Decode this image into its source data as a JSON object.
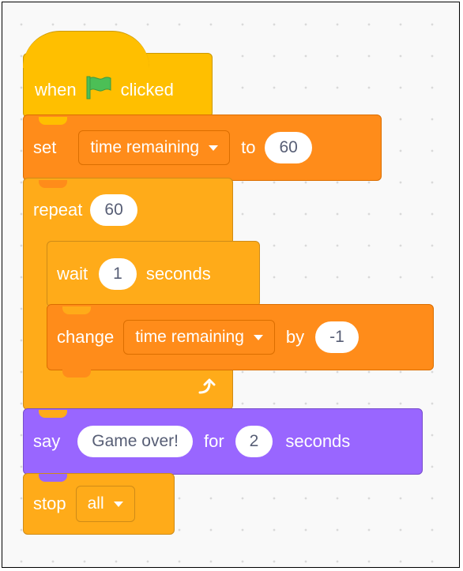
{
  "script": {
    "hat": {
      "when_label": "when",
      "clicked_label": "clicked"
    },
    "set_block": {
      "label": "set",
      "variable": "time remaining",
      "to_label": "to",
      "value": "60"
    },
    "repeat_block": {
      "label": "repeat",
      "count": "60"
    },
    "wait_block": {
      "label": "wait",
      "value": "1",
      "unit_label": "seconds"
    },
    "change_block": {
      "label": "change",
      "variable": "time remaining",
      "by_label": "by",
      "value": "-1"
    },
    "say_block": {
      "label": "say",
      "message": "Game over!",
      "for_label": "for",
      "duration": "2",
      "unit_label": "seconds"
    },
    "stop_block": {
      "label": "stop",
      "option": "all"
    }
  },
  "icons": {
    "flag": "green-flag-icon",
    "loop_arrow": "loop-arrow-icon",
    "dropdown": "caret-down-icon"
  },
  "colors": {
    "events": "#ffbf00",
    "variables": "#ff8c1a",
    "control": "#ffab19",
    "looks": "#9966ff",
    "flag": "#4cbf56"
  }
}
